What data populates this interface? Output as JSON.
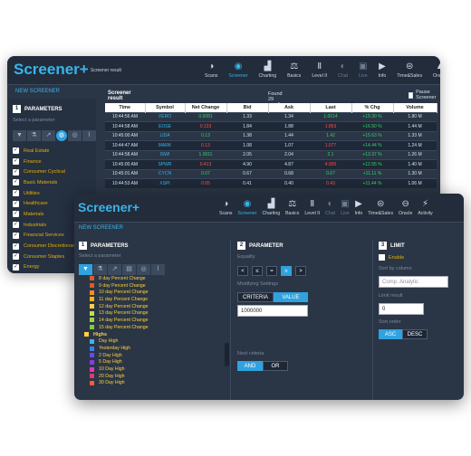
{
  "back": {
    "logo": "Screener+",
    "header_sub": "Screener result",
    "nav": [
      {
        "label": "Scans",
        "icon": "◑",
        "state": "normal"
      },
      {
        "label": "Screener",
        "icon": "◉",
        "state": "active"
      },
      {
        "label": "Charting",
        "icon": "▟",
        "state": "normal"
      },
      {
        "label": "Basics",
        "icon": "⚖",
        "state": "normal"
      },
      {
        "label": "Level II",
        "icon": "Ⅱ",
        "state": "normal"
      },
      {
        "label": "Chat",
        "icon": "◐",
        "state": "dim"
      },
      {
        "label": "Live",
        "icon": "▣",
        "state": "dim"
      },
      {
        "label": "Info",
        "icon": "▶",
        "state": "normal"
      },
      {
        "label": "Time&Sales",
        "icon": "⊜",
        "state": "normal"
      },
      {
        "label": "Oracle",
        "icon": "▲",
        "state": "normal"
      }
    ],
    "new_screener": "NEW SCREENER",
    "parameters": {
      "num": "1",
      "title": "PARAMETERS",
      "hint": "Select a parameter"
    },
    "categories": [
      "Real Estate",
      "Finance",
      "Consumer Cyclical",
      "Basic Materials",
      "Utilities",
      "Healthcare",
      "Materials",
      "Industrials",
      "Financial Services",
      "Consumer Discretionary",
      "Consumer Staples",
      "Energy"
    ],
    "results": {
      "title": "Screener result",
      "count": "Found 29 results",
      "pause": "Pause Screener",
      "columns": [
        "Time",
        "Symbol",
        "Net Change",
        "Bid",
        "Ask",
        "Last",
        "% Chg",
        "Volume"
      ],
      "rows": [
        [
          "10:44:56 AM",
          "VERO",
          "0.0081",
          "1.33",
          "1.34",
          "1.0014",
          "+19.30 %",
          "1.80 M"
        ],
        [
          "10:44:58 AM",
          "EOSE",
          "0.133",
          "1.84",
          "1.88",
          "1.863",
          "+16.50 %",
          "1.44 M"
        ],
        [
          "10:45:00 AM",
          "LIDA",
          "0.13",
          "1.38",
          "1.44",
          "1.42",
          "+15.63 %",
          "1.33 M"
        ],
        [
          "10:44:47 AM",
          "MARK",
          "0.13",
          "1.08",
          "1.07",
          "1.077",
          "+14.44 %",
          "1.24 M"
        ],
        [
          "10:44:58 AM",
          "ISWI",
          "1.0011",
          "2.05",
          "2.04",
          "2.1",
          "+13.37 %",
          "1.26 M"
        ],
        [
          "10:45:00 AM",
          "SPWR",
          "0.413",
          "4.90",
          "4.87",
          "4.900",
          "+12.55 %",
          "1.40 M"
        ],
        [
          "10:45:01 AM",
          "CYCN",
          "0.07",
          "0.67",
          "0.68",
          "0.67",
          "+11.11 %",
          "1.30 M"
        ],
        [
          "10:44:53 AM",
          "XSPI",
          "0.05",
          "0.41",
          "0.40",
          "0.43",
          "+11.44 %",
          "1.06 M"
        ]
      ],
      "row_dir": [
        "up",
        "dn",
        "up",
        "dn",
        "up",
        "dn",
        "up",
        "dn"
      ]
    }
  },
  "front": {
    "logo": "Screener+",
    "nav": [
      {
        "label": "Scans",
        "icon": "◑",
        "state": "normal"
      },
      {
        "label": "Screener",
        "icon": "◉",
        "state": "active"
      },
      {
        "label": "Charting",
        "icon": "▟",
        "state": "normal"
      },
      {
        "label": "Basics",
        "icon": "⚖",
        "state": "normal"
      },
      {
        "label": "Level II",
        "icon": "Ⅱ",
        "state": "normal"
      },
      {
        "label": "Chat",
        "icon": "◐",
        "state": "dim"
      },
      {
        "label": "Live",
        "icon": "▣",
        "state": "dim"
      },
      {
        "label": "Info",
        "icon": "▶",
        "state": "normal"
      },
      {
        "label": "Time&Sales",
        "icon": "⊜",
        "state": "normal"
      },
      {
        "label": "Oracle",
        "icon": "⊖",
        "state": "normal"
      },
      {
        "label": "Activity",
        "icon": "⚡",
        "state": "normal"
      }
    ],
    "new_screener": "NEW SCREENER",
    "parameters": {
      "num": "1",
      "title": "PARAMETERS",
      "hint": "Select a parameter"
    },
    "param_items": [
      {
        "label": "8 day Percent Change",
        "color": "#e0592b"
      },
      {
        "label": "9 day Percent Change",
        "color": "#e0592b"
      },
      {
        "label": "10 day Percent Change",
        "color": "#ff8c1a"
      },
      {
        "label": "11 day Percent Change",
        "color": "#ffb31a"
      },
      {
        "label": "12 day Percent Change",
        "color": "#ffd23f"
      },
      {
        "label": "13 day Percent Change",
        "color": "#c6e03a"
      },
      {
        "label": "14 day Percent Change",
        "color": "#9fd63a"
      },
      {
        "label": "15 day Percent Change",
        "color": "#7ccc3a"
      }
    ],
    "highs_group": {
      "label": "Highs",
      "color": "#ffd23f"
    },
    "highs_items": [
      {
        "label": "Day High",
        "color": "#3ab4ea"
      },
      {
        "label": "Yesterday High",
        "color": "#3a7fea"
      },
      {
        "label": "2 Day High",
        "color": "#6a4be0"
      },
      {
        "label": "5 Day High",
        "color": "#8a3ae0"
      },
      {
        "label": "10 Day High",
        "color": "#e03ab0"
      },
      {
        "label": "20 Day High",
        "color": "#e03a6a"
      },
      {
        "label": "30 Day High",
        "color": "#ff5a3a"
      }
    ],
    "parameter": {
      "num": "2",
      "title": "PARAMETER",
      "equality": "Equality",
      "ops": [
        "<",
        "≤",
        "=",
        "≥",
        ">"
      ],
      "active_op": 3,
      "modifying": "Modifying Settings",
      "criteria": "CRITERIA",
      "value": "VALUE",
      "value_input": "1000000",
      "next_criteria": "Next criteria",
      "and": "AND",
      "or": "OR"
    },
    "limit": {
      "num": "3",
      "title": "LIMIT",
      "enable": "Enable",
      "sort_by": "Sort by column",
      "sort_by_value": "Comp. Analytic",
      "limit_result": "Limit result",
      "limit_value": "0",
      "sort_order": "Sort order",
      "asc": "ASC",
      "desc": "DESC"
    }
  }
}
